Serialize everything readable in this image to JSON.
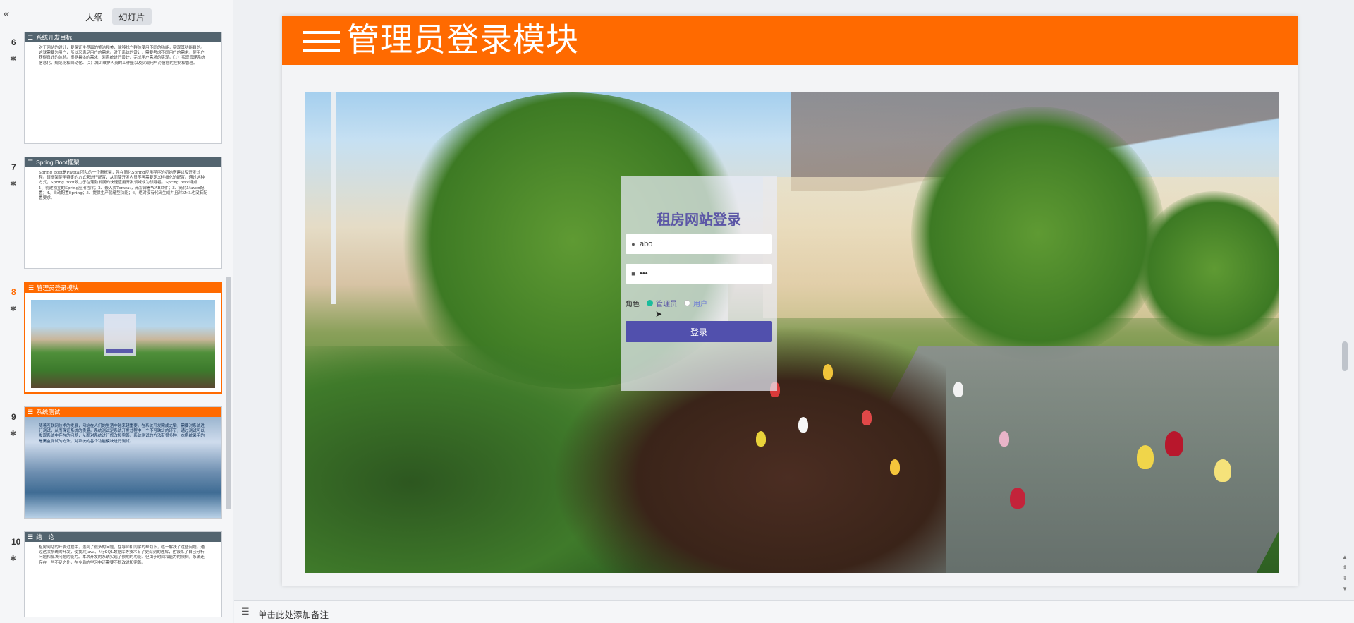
{
  "panel": {
    "collapse_icon": "double-chevron-left-icon",
    "tabs": [
      {
        "label": "大纲",
        "active": false
      },
      {
        "label": "幻灯片",
        "active": true
      }
    ]
  },
  "thumbnails": [
    {
      "number": "6",
      "title": "系统开发目标",
      "text": "对于网站的设计，要保证主界面的整洁和美，能够找户群体使用不同的功能，实现其功能目的。这就需要为用户，所以来满足用户的需求。对于系统的设计，需要考虑不同用户的需求，使用户获得良好的体验。根据具体的需求，对系统进行设计，完成用户需求的实现。（1）实现管理系统信息化，规范化和自动化。（2）减少维护人员的工作量以及实现用户对信息的控制和管理。"
    },
    {
      "number": "7",
      "title": "Spring Boot框架",
      "text": "Spring Boot是Pivotal团队的一个新框架，旨在简化Spring应用程序的初始搭建以及开发过程。该框架使用特定的方式来进行配置，从而使开发人员不再需要定义样板化的配置。通过这种方式，Spring Boot致力于在蓬勃发展的快速应用开发领域成为领导者。Spring Boot特点：1、创建独立的Spring应用程序；2、嵌入式Tomcat，无需部署WAR文件；3、简化Maven配置；4、自动配置Spring；5、提供生产就绪型功能；6、绝对没有代码生成并且对XML也没有配置要求。"
    },
    {
      "number": "8",
      "title": "管理员登录模块",
      "active": true
    },
    {
      "number": "9",
      "title": "系统测试",
      "text": "随着互联网技术的发展，网站在人们的生活中越来越重要。在系统开发完成之后，需要对系统进行测试，从而保证系统的质量。系统测试是系统开发过程中一个不可缺少的环节，通过测试可以发现系统中存在的问题，从而对系统进行修改和完善。系统测试的方法有很多种，本系统采用的是黑盒测试的方法，对系统的各个功能模块进行测试。"
    },
    {
      "number": "10",
      "title": "结　论",
      "text": "租房网站的开发过程中，遇到了很多的问题，在导师和同学的帮助下，逐一解决了这些问题。通过这次系统的开发，使我对Java、MySQL数据库等技术有了更深刻的理解，也锻炼了自己分析问题和解决问题的能力。本次开发的系统实现了预期的功能，但由于时间和能力的限制，系统还存在一些不足之处，在今后的学习中还需要不断改进和完善。"
    }
  ],
  "slide": {
    "title": "管理员登录模块",
    "header_icon": "hamburger-lines-icon",
    "login": {
      "title": "租房网站登录",
      "username_value": "abo",
      "password_value": "•••",
      "user_icon": "user-icon",
      "lock_icon": "lock-icon",
      "role_label": "角色",
      "roles": [
        {
          "label": "管理员",
          "selected": true
        },
        {
          "label": "用户",
          "selected": false
        }
      ],
      "button_label": "登录"
    }
  },
  "notes": {
    "placeholder": "单击此处添加备注",
    "icon": "notes-list-icon"
  },
  "colors": {
    "accent": "#ff6a00",
    "login_button": "#5150ad",
    "login_title": "#5b56a6",
    "radio_selected": "#1abc9c"
  }
}
